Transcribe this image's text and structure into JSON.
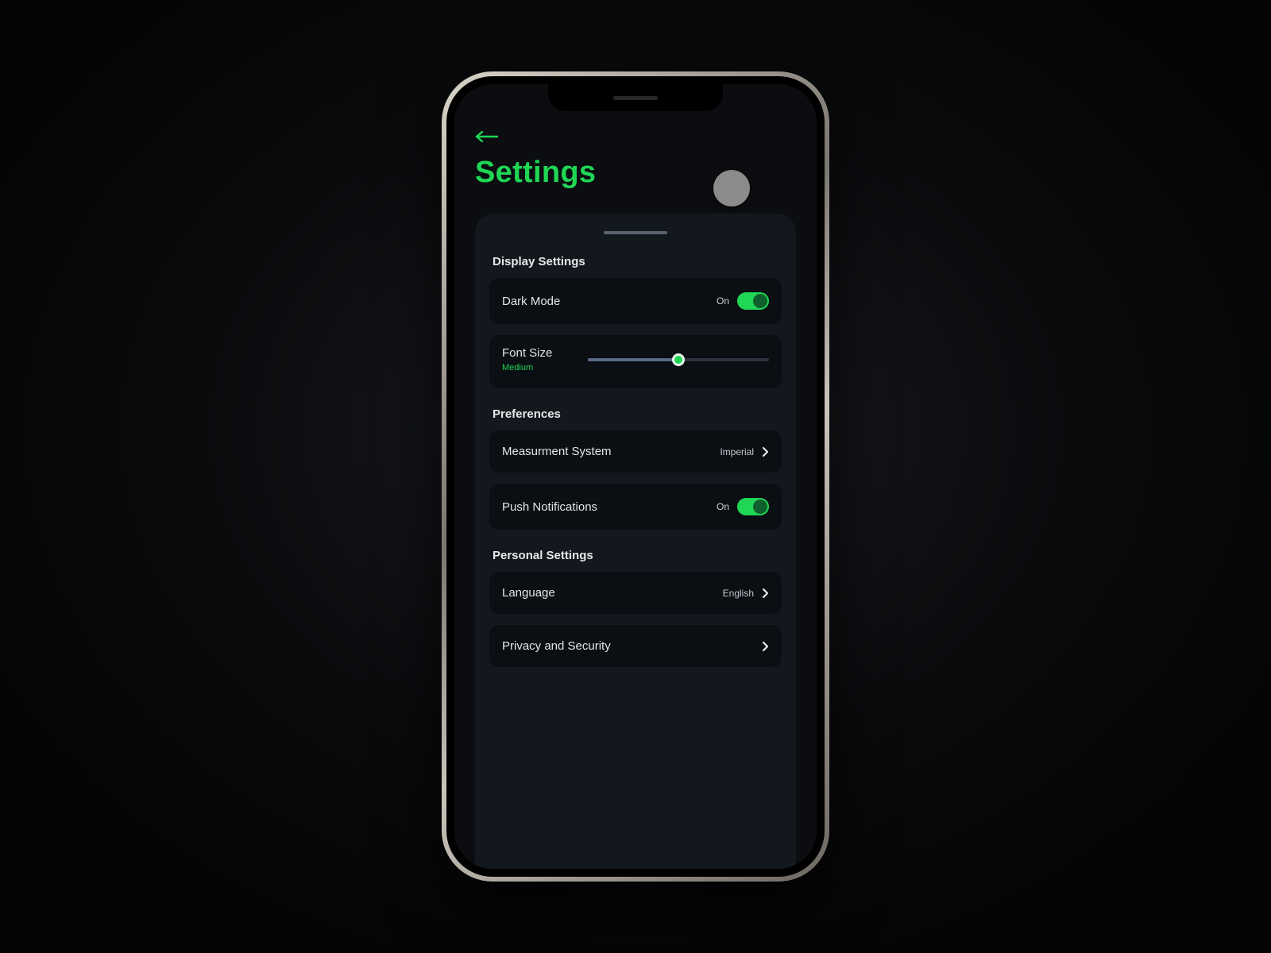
{
  "header": {
    "title": "Settings"
  },
  "sections": {
    "display": {
      "title": "Display Settings",
      "dark_mode": {
        "label": "Dark Mode",
        "state": "On"
      },
      "font_size": {
        "label": "Font Size",
        "value": "Medium"
      }
    },
    "preferences": {
      "title": "Preferences",
      "measurement": {
        "label": "Measurment System",
        "value": "Imperial"
      },
      "push": {
        "label": "Push Notifications",
        "state": "On"
      }
    },
    "personal": {
      "title": "Personal Settings",
      "language": {
        "label": "Language",
        "value": "English"
      },
      "privacy": {
        "label": "Privacy and Security"
      }
    }
  },
  "colors": {
    "accent": "#1fd655",
    "sheet": "#13181f",
    "row": "#0b0e12"
  }
}
